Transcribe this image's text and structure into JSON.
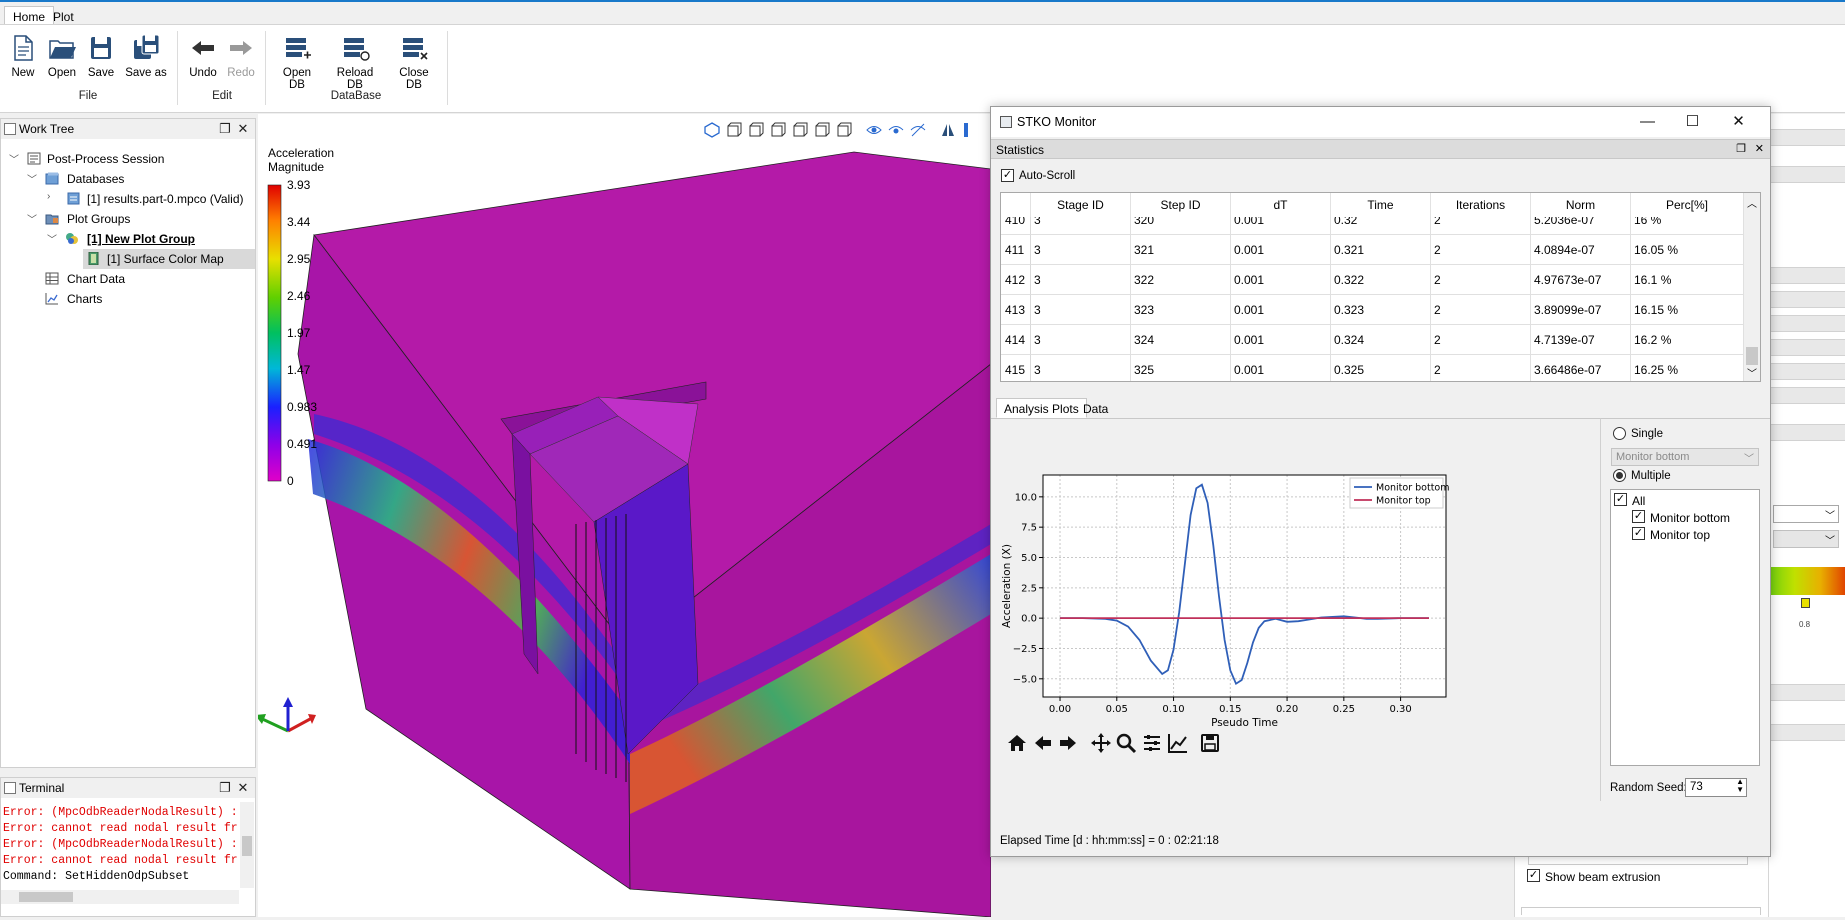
{
  "ribbon": {
    "tabs": [
      "Home",
      "Plot"
    ],
    "groups": {
      "file": "File",
      "edit": "Edit",
      "database": "DataBase"
    },
    "buttons": {
      "new": "New",
      "open": "Open",
      "save": "Save",
      "save_as": "Save as",
      "undo": "Undo",
      "redo": "Redo",
      "open_db": "Open DB",
      "reload_db": "Reload DB",
      "close_db": "Close DB"
    }
  },
  "work_tree": {
    "title": "Work Tree",
    "items": [
      {
        "label": "Post-Process Session"
      },
      {
        "label": "Databases"
      },
      {
        "label": "[1] results.part-0.mpco (Valid)"
      },
      {
        "label": "Plot Groups"
      },
      {
        "label": "[1] New Plot Group"
      },
      {
        "label": "[1] Surface Color Map"
      },
      {
        "label": "Chart Data"
      },
      {
        "label": "Charts"
      }
    ]
  },
  "terminal": {
    "title": "Terminal",
    "lines": [
      "Error: (MpcOdbReaderNodalResult) :",
      "Error: cannot read nodal result fr",
      "Error: (MpcOdbReaderNodalResult) :",
      "Error: cannot read nodal result fr",
      "Command: SetHiddenOdpSubset"
    ]
  },
  "legend": {
    "title_line1": "Acceleration",
    "title_line2": "Magnitude",
    "values": [
      "3.93",
      "3.44",
      "2.95",
      "2.46",
      "1.97",
      "1.47",
      "0.983",
      "0.491",
      "0"
    ]
  },
  "monitor": {
    "title": "STKO Monitor",
    "statistics_label": "Statistics",
    "auto_scroll": "Auto-Scroll",
    "columns": [
      "Stage ID",
      "Step ID",
      "dT",
      "Time",
      "Iterations",
      "Norm",
      "Perc[%]"
    ],
    "rows": [
      {
        "n": "410",
        "cells": [
          "3",
          "320",
          "0.001",
          "0.32",
          "2",
          "5.2036e-07",
          "16 %"
        ]
      },
      {
        "n": "411",
        "cells": [
          "3",
          "321",
          "0.001",
          "0.321",
          "2",
          "4.0894e-07",
          "16.05 %"
        ]
      },
      {
        "n": "412",
        "cells": [
          "3",
          "322",
          "0.001",
          "0.322",
          "2",
          "4.97673e-07",
          "16.1 %"
        ]
      },
      {
        "n": "413",
        "cells": [
          "3",
          "323",
          "0.001",
          "0.323",
          "2",
          "3.89099e-07",
          "16.15 %"
        ]
      },
      {
        "n": "414",
        "cells": [
          "3",
          "324",
          "0.001",
          "0.324",
          "2",
          "4.7139e-07",
          "16.2 %"
        ]
      },
      {
        "n": "415",
        "cells": [
          "3",
          "325",
          "0.001",
          "0.325",
          "2",
          "3.66486e-07",
          "16.25 %"
        ]
      }
    ],
    "tabs": [
      "Analysis Plots",
      "Data"
    ],
    "single_label": "Single",
    "single_select": "Monitor bottom",
    "multiple_label": "Multiple",
    "list": [
      "All",
      "Monitor bottom",
      "Monitor top"
    ],
    "random_seed_label": "Random Seed:",
    "random_seed_value": "73",
    "elapsed": "Elapsed Time [d : hh:mm:ss] = 0 : 02:21:18"
  },
  "right_panel": {
    "checkbox_label": "Show beam extrusion",
    "tick_label": "0.8"
  },
  "chart_data": {
    "type": "line",
    "xlabel": "Pseudo Time",
    "ylabel": "Acceleration (X)",
    "xlim": [
      -0.015,
      0.34
    ],
    "ylim": [
      -6.5,
      11.8
    ],
    "xticks": [
      0.0,
      0.05,
      0.1,
      0.15,
      0.2,
      0.25,
      0.3
    ],
    "xtick_labels": [
      "0.00",
      "0.05",
      "0.10",
      "0.15",
      "0.20",
      "0.25",
      "0.30"
    ],
    "yticks": [
      -5.0,
      -2.5,
      0.0,
      2.5,
      5.0,
      7.5,
      10.0
    ],
    "ytick_labels": [
      "−5.0",
      "−2.5",
      "0.0",
      "2.5",
      "5.0",
      "7.5",
      "10.0"
    ],
    "grid": true,
    "legend": "top-right",
    "series": [
      {
        "name": "Monitor bottom",
        "color": "#2f5fb8",
        "x": [
          0.0,
          0.02,
          0.04,
          0.05,
          0.06,
          0.07,
          0.08,
          0.09,
          0.095,
          0.1,
          0.105,
          0.11,
          0.115,
          0.12,
          0.125,
          0.13,
          0.135,
          0.14,
          0.145,
          0.15,
          0.155,
          0.16,
          0.165,
          0.17,
          0.175,
          0.18,
          0.19,
          0.2,
          0.21,
          0.22,
          0.23,
          0.24,
          0.25,
          0.26,
          0.27,
          0.28,
          0.3,
          0.325
        ],
        "y": [
          0.0,
          0.0,
          -0.05,
          -0.2,
          -0.7,
          -1.8,
          -3.5,
          -4.6,
          -4.3,
          -2.6,
          0.5,
          4.5,
          8.5,
          10.7,
          11.0,
          9.5,
          6.0,
          1.8,
          -1.8,
          -4.3,
          -5.4,
          -5.1,
          -3.7,
          -2.0,
          -0.8,
          -0.25,
          -0.05,
          -0.3,
          -0.25,
          -0.1,
          0.05,
          0.1,
          0.15,
          0.05,
          -0.05,
          -0.05,
          0.0,
          0.0
        ]
      },
      {
        "name": "Monitor top",
        "color": "#c0305a",
        "x": [
          0.0,
          0.325
        ],
        "y": [
          0.0,
          0.0
        ]
      }
    ]
  },
  "colors": {
    "accent": "#1979ca",
    "mesh_magenta": "#b41aa8"
  }
}
